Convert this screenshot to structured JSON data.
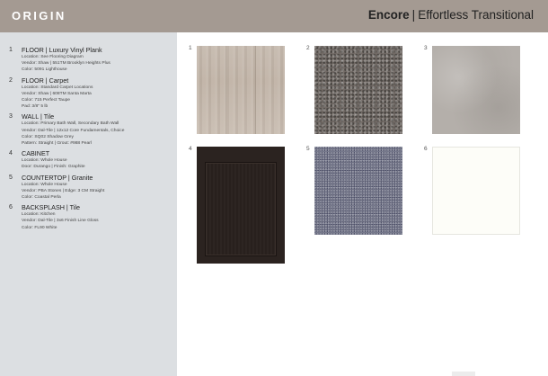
{
  "header": {
    "brand": "ORIGIN",
    "collection_name": "Encore",
    "separator": "|",
    "collection_style": "Effortless Transitional"
  },
  "items": [
    {
      "num": "1",
      "title": "FLOOR | Luxury Vinyl Plank",
      "lines": [
        "Location: See Flooring Diagram",
        "Vendor: Shaw | 551TM Brooklyn Heights Plus",
        "Color: 5091 Lighthouse"
      ]
    },
    {
      "num": "2",
      "title": "FLOOR | Carpet",
      "lines": [
        "Location: Standard Carpet Locations",
        "Vendor: Shaw | 608TM Santa Marta",
        "Color: 715 Perfect Taupe",
        "Pad: 3/8\" 5 lb"
      ]
    },
    {
      "num": "3",
      "title": "WALL | Tile",
      "lines": [
        "Location: Primary Bath Wall, Secondary Bath Wall",
        "Vendor: Dal-Tile | 12x12 Core Fundamentals, Choice",
        "Color: SQ02 Shadow Grey",
        "Pattern: Straight | Grout: #988 Pearl"
      ]
    },
    {
      "num": "4",
      "title": "CABINET",
      "lines": [
        "Location: Whole House",
        "Door: Durango | Finish: Graphite"
      ]
    },
    {
      "num": "5",
      "title": "COUNTERTOP | Granite",
      "lines": [
        "Location: Whole House",
        "Vendor: PBA Stones | Edge: 3 CM Straight",
        "Color: Coastal Perla"
      ]
    },
    {
      "num": "6",
      "title": "BACKSPLASH | Tile",
      "lines": [
        "Location: Kitchen",
        "Vendor: Dal-Tile | 3x6 Finish Line Gloss",
        "Color: FL90 White"
      ]
    }
  ],
  "swatches": [
    {
      "num": "1",
      "icon": "vinyl-plank-swatch",
      "color": "#c5b9ad"
    },
    {
      "num": "2",
      "icon": "carpet-swatch",
      "color": "#726b66"
    },
    {
      "num": "3",
      "icon": "wall-tile-swatch",
      "color": "#b4afaa"
    },
    {
      "num": "4",
      "icon": "cabinet-door-swatch",
      "color": "#2b2320"
    },
    {
      "num": "5",
      "icon": "granite-swatch",
      "color": "#777a8c"
    },
    {
      "num": "6",
      "icon": "backsplash-tile-swatch",
      "color": "#fdfdf8"
    }
  ],
  "colors": {
    "header_bg": "#a49a92",
    "sidebar_bg": "#dcdfe2"
  }
}
